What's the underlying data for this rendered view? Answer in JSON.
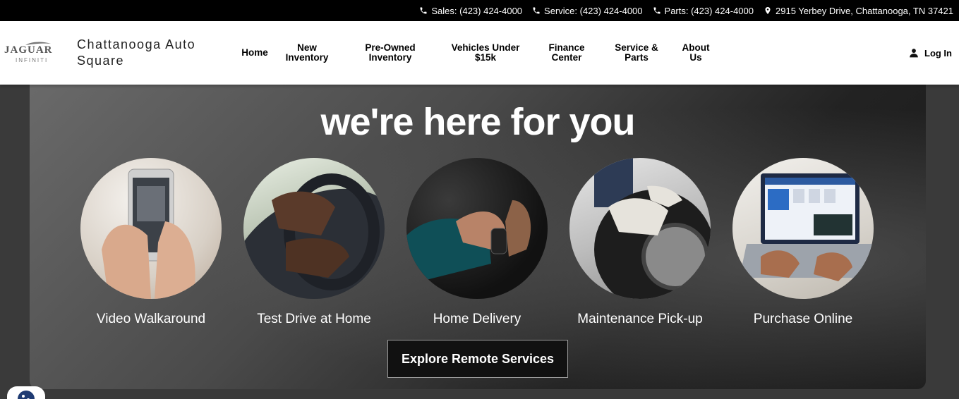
{
  "topbar": {
    "sales": "Sales: (423) 424-4000",
    "service": "Service: (423) 424-4000",
    "parts": "Parts: (423) 424-4000",
    "address": "2915 Yerbey Drive, Chattanooga, TN 37421"
  },
  "logo": {
    "line1": "JAGUAR",
    "line2": "INFINITI"
  },
  "dealer_name": "Chattanooga Auto Square",
  "nav": [
    {
      "label": "Home"
    },
    {
      "label": "New Inventory"
    },
    {
      "label": "Pre-Owned Inventory"
    },
    {
      "label": "Vehicles Under $15k"
    },
    {
      "label": "Finance Center"
    },
    {
      "label": "Service & Parts"
    },
    {
      "label": "About Us"
    }
  ],
  "login_label": "Log In",
  "hero": {
    "heading": "we're here for you",
    "services": [
      {
        "label": "Video Walkaround"
      },
      {
        "label": "Test Drive at Home"
      },
      {
        "label": "Home Delivery"
      },
      {
        "label": "Maintenance Pick-up"
      },
      {
        "label": "Purchase Online"
      }
    ],
    "cta": "Explore Remote Services"
  },
  "colors": {
    "topbar": "#000000",
    "header": "#ffffff",
    "hero_dark": "#1a1a1a",
    "text_light": "#ffffff"
  }
}
